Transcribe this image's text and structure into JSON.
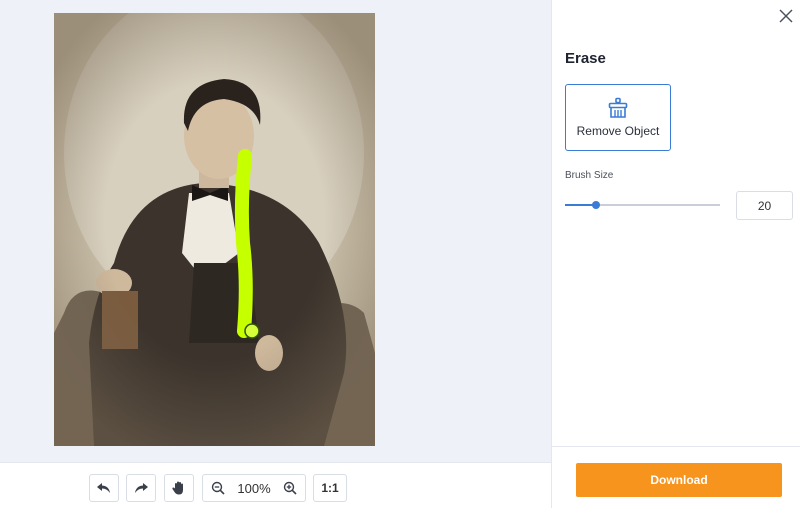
{
  "panel": {
    "title": "Erase",
    "close_icon": "close-icon",
    "tool": {
      "label": "Remove Object",
      "icon": "brush-icon"
    },
    "brush_size_label": "Brush Size",
    "brush_size_value": "20",
    "brush_size_fraction": 0.2
  },
  "toolbar": {
    "undo_icon": "undo-icon",
    "redo_icon": "redo-icon",
    "pan_icon": "hand-icon",
    "zoom_out_icon": "zoom-out-icon",
    "zoom_in_icon": "zoom-in-icon",
    "zoom_level": "100%",
    "actual_size_label": "1:1"
  },
  "download_label": "Download",
  "colors": {
    "accent": "#3a7bd5",
    "download": "#f7941d",
    "brush_stroke": "#c6ff00"
  }
}
